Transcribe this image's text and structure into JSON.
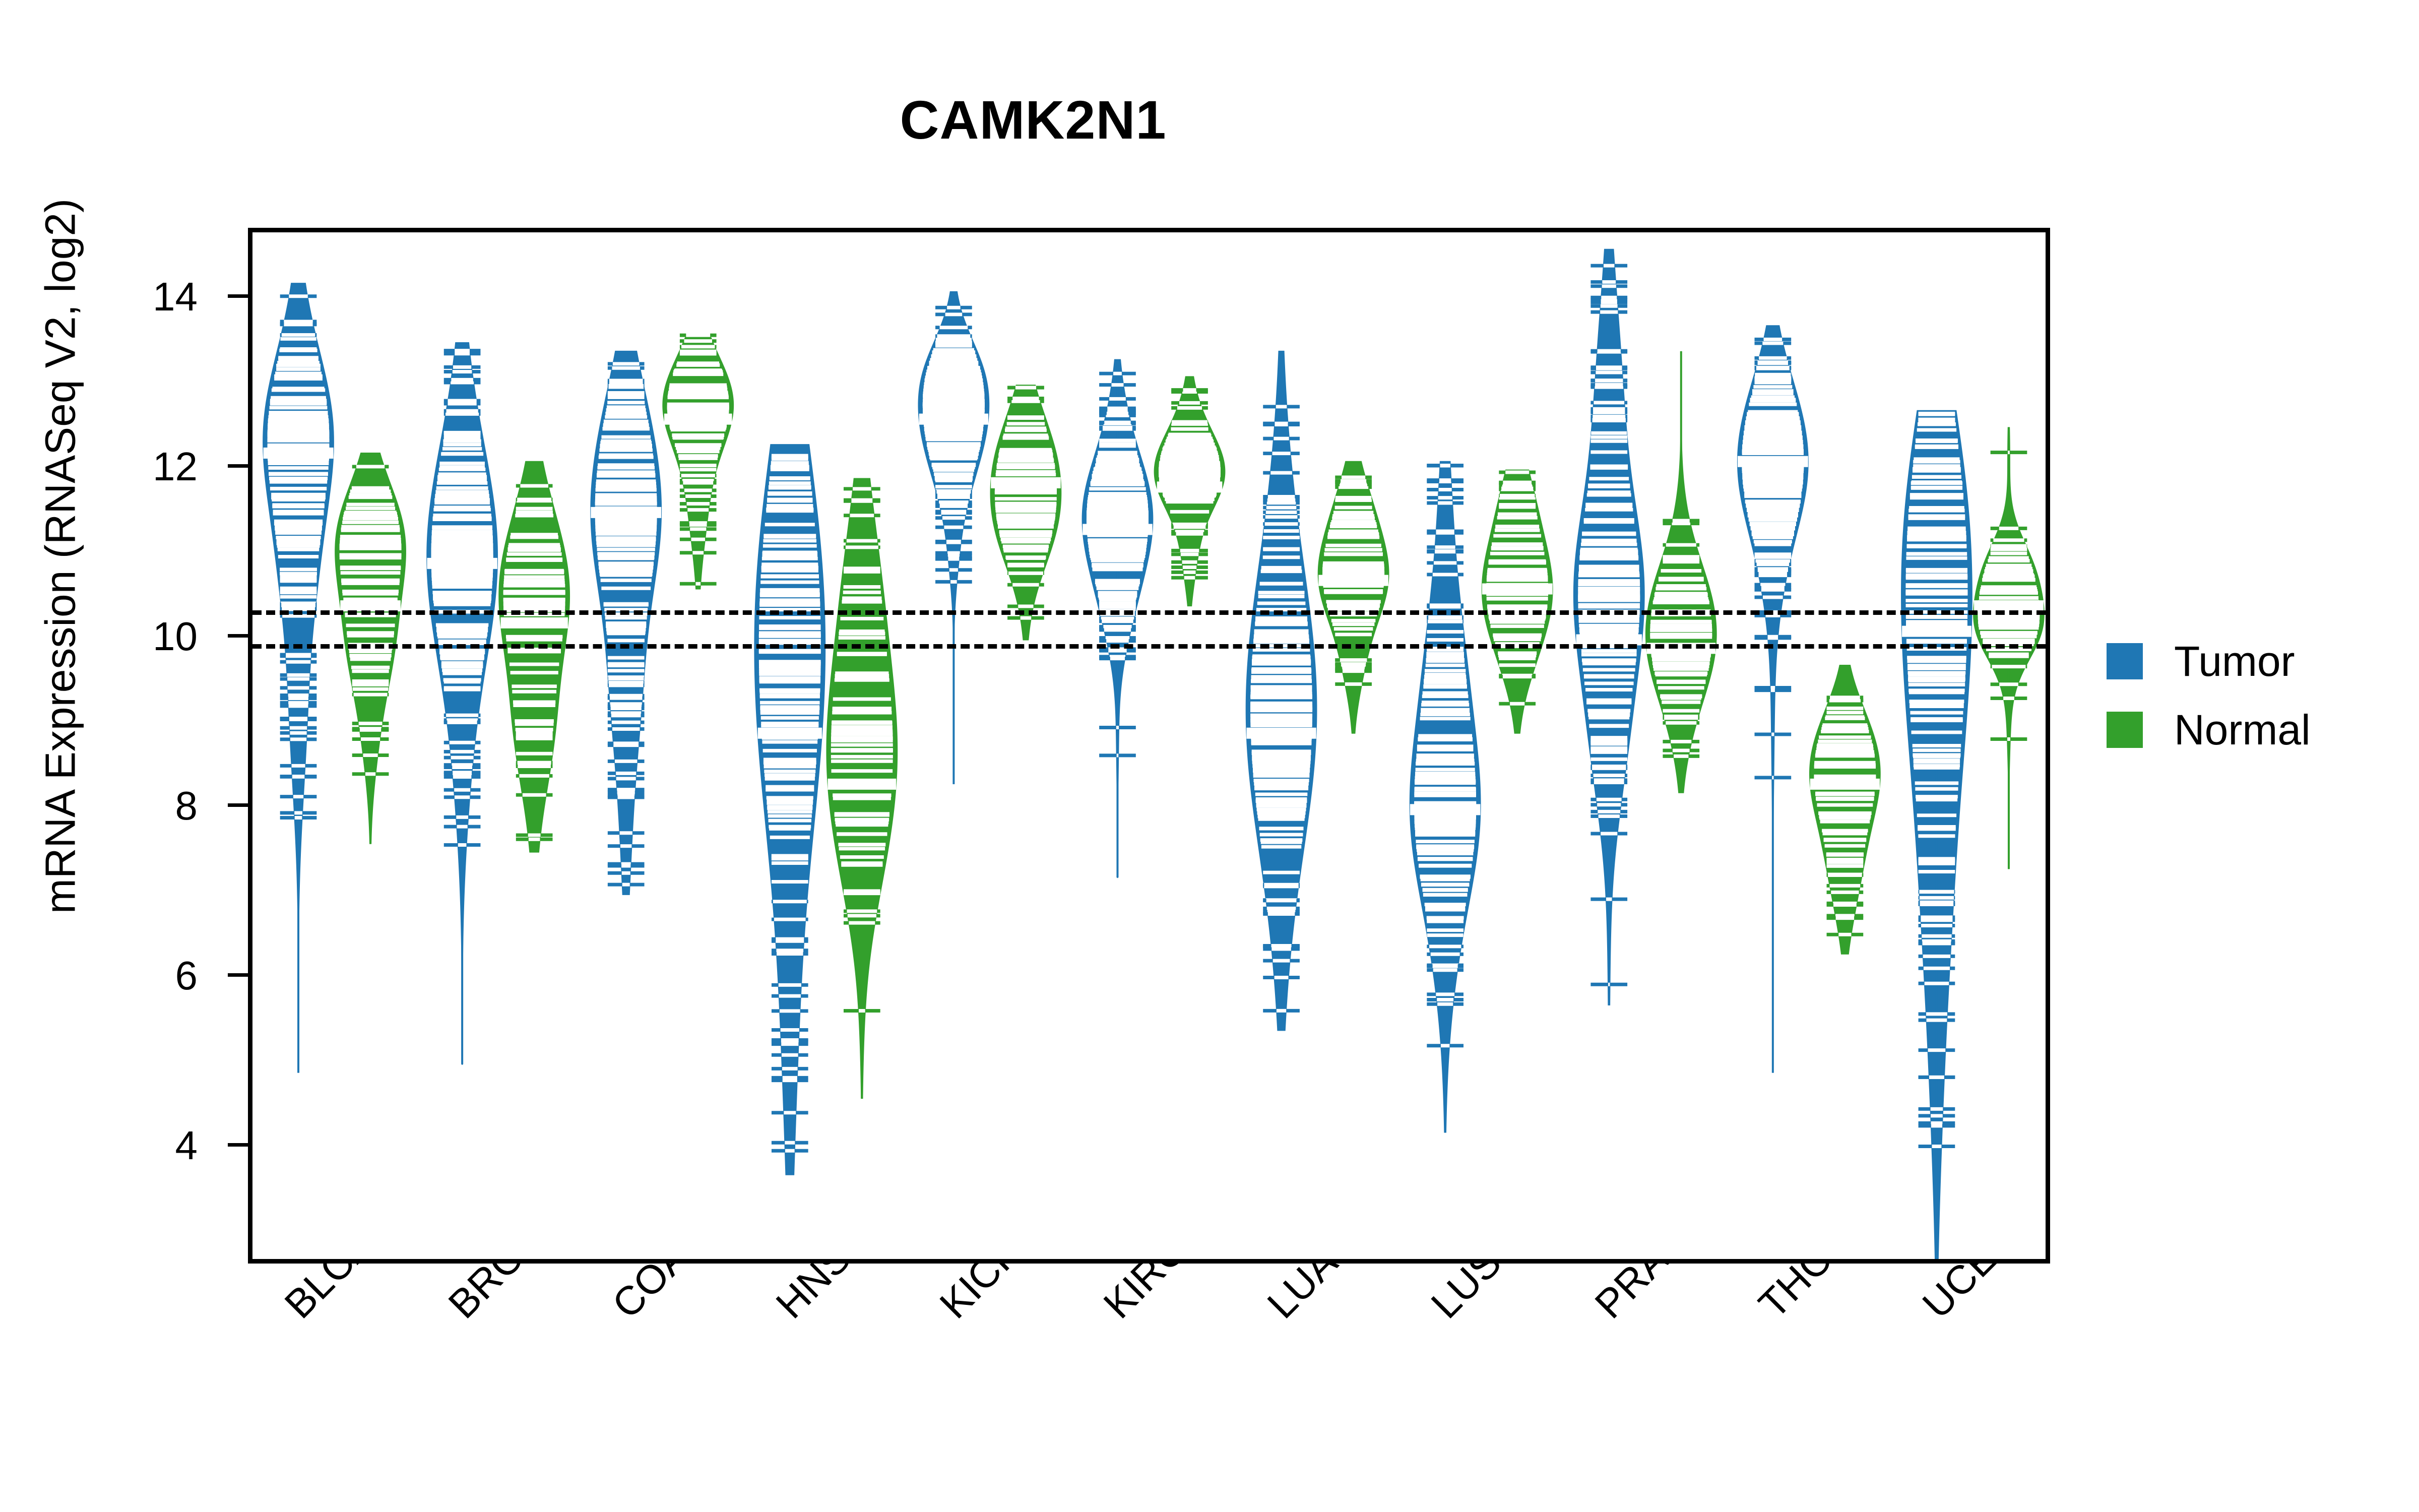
{
  "title": "CAMK2N1",
  "axes": {
    "y_label": "mRNA Expression (RNASeq V2, log2)",
    "y_ticks": [
      "4",
      "6",
      "8",
      "10",
      "12",
      "14"
    ],
    "x_label": ""
  },
  "legend": {
    "position": "right",
    "items": [
      {
        "label": "Tumor",
        "color": "#1f77b4"
      },
      {
        "label": "Normal",
        "color": "#33a02c"
      }
    ]
  },
  "colors": {
    "tumor": "#1f77b4",
    "normal": "#33a02c",
    "axis": "#000000",
    "background": "#ffffff",
    "reference_line": "#000000"
  },
  "chart_data": {
    "type": "violin",
    "title": "CAMK2N1",
    "xlabel": "",
    "ylabel": "mRNA Expression (RNASeq V2, log2)",
    "ylim": [
      2.6,
      14.8
    ],
    "yticks": [
      4,
      6,
      8,
      10,
      12,
      14
    ],
    "grid": false,
    "legend_position": "right",
    "reference_lines": [
      10.35,
      9.95
    ],
    "categories": [
      "BLCA",
      "BRCA",
      "COAD",
      "HNSC",
      "KICH",
      "KIRC",
      "LUAD",
      "LUSC",
      "PRAD",
      "THCA",
      "UCEC"
    ],
    "series": [
      {
        "name": "Tumor",
        "color": "#1f77b4",
        "groups": [
          {
            "category": "BLCA",
            "median": 12.2,
            "q1": 11.1,
            "q3": 12.8,
            "min": 4.9,
            "max": 14.2,
            "peak": 12.3,
            "peak2": 10.2
          },
          {
            "category": "BRCA",
            "median": 10.9,
            "q1": 9.9,
            "q3": 11.9,
            "min": 5.0,
            "max": 13.5,
            "peak": 10.9,
            "peak2": 10.2
          },
          {
            "category": "COAD",
            "median": 11.5,
            "q1": 10.6,
            "q3": 12.3,
            "min": 7.0,
            "max": 13.4,
            "peak": 11.6,
            "peak2": 9.3
          },
          {
            "category": "HNSC",
            "median": 8.9,
            "q1": 7.5,
            "q3": 11.0,
            "min": 3.7,
            "max": 12.3,
            "peak": 11.4,
            "peak2": 8.3
          },
          {
            "category": "KICH",
            "median": 12.6,
            "q1": 12.1,
            "q3": 13.0,
            "min": 8.3,
            "max": 14.1,
            "peak": 12.7,
            "peak2": 12.2
          },
          {
            "category": "KIRC",
            "median": 11.3,
            "q1": 10.7,
            "q3": 11.8,
            "min": 7.2,
            "max": 13.3,
            "peak": 11.5,
            "peak2": 11.1
          },
          {
            "category": "LUAD",
            "median": 8.9,
            "q1": 7.9,
            "q3": 10.4,
            "min": 5.4,
            "max": 13.4,
            "peak": 8.9,
            "peak2": 10.1
          },
          {
            "category": "LUSC",
            "median": 8.0,
            "q1": 7.3,
            "q3": 9.3,
            "min": 4.2,
            "max": 12.1,
            "peak": 8.0,
            "peak2": 9.6
          },
          {
            "category": "PRAD",
            "median": 10.0,
            "q1": 9.2,
            "q3": 11.1,
            "min": 5.7,
            "max": 14.6,
            "peak": 10.0,
            "peak2": 12.5
          },
          {
            "category": "THCA",
            "median": 12.1,
            "q1": 11.5,
            "q3": 12.7,
            "min": 4.9,
            "max": 13.7,
            "peak": 12.2,
            "peak2": 11.6
          },
          {
            "category": "UCEC",
            "median": 10.1,
            "q1": 8.4,
            "q3": 11.4,
            "min": 2.7,
            "max": 12.7,
            "peak": 10.4,
            "peak2": 8.0
          }
        ]
      },
      {
        "name": "Normal",
        "color": "#33a02c",
        "groups": [
          {
            "category": "BLCA",
            "median": 10.4,
            "q1": 9.9,
            "q3": 11.1,
            "min": 7.6,
            "max": 12.2,
            "peak": 11.0,
            "peak2": 10.2
          },
          {
            "category": "BRCA",
            "median": 10.2,
            "q1": 9.4,
            "q3": 10.9,
            "min": 7.5,
            "max": 12.1,
            "peak": 10.4,
            "peak2": 9.7
          },
          {
            "category": "COAD",
            "median": 12.6,
            "q1": 12.1,
            "q3": 13.0,
            "min": 10.6,
            "max": 13.6,
            "peak": 12.8,
            "peak2": 12.3
          },
          {
            "category": "HNSC",
            "median": 8.3,
            "q1": 7.7,
            "q3": 9.6,
            "min": 4.6,
            "max": 11.9,
            "peak": 8.3,
            "peak2": 10.4
          },
          {
            "category": "KICH",
            "median": 11.85,
            "q1": 11.3,
            "q3": 12.3,
            "min": 10.0,
            "max": 13.0,
            "peak": 11.9,
            "peak2": 11.6
          },
          {
            "category": "KIRC",
            "median": 11.8,
            "q1": 11.4,
            "q3": 12.2,
            "min": 10.4,
            "max": 13.1,
            "peak": 11.9,
            "peak2": 11.7
          },
          {
            "category": "LUAD",
            "median": 10.7,
            "q1": 10.2,
            "q3": 11.2,
            "min": 8.9,
            "max": 12.1,
            "peak": 10.9,
            "peak2": 10.4
          },
          {
            "category": "LUSC",
            "median": 10.6,
            "q1": 10.1,
            "q3": 11.2,
            "min": 8.9,
            "max": 12.0,
            "peak": 10.8,
            "peak2": 10.4
          },
          {
            "category": "PRAD",
            "median": 9.9,
            "q1": 9.4,
            "q3": 10.5,
            "min": 8.2,
            "max": 13.4,
            "peak": 10.3,
            "peak2": 9.8
          },
          {
            "category": "THCA",
            "median": 8.3,
            "q1": 7.8,
            "q3": 8.8,
            "min": 6.3,
            "max": 9.7,
            "peak": 8.4,
            "peak2": 7.9
          },
          {
            "category": "UCEC",
            "median": 10.4,
            "q1": 10.0,
            "q3": 10.8,
            "min": 7.3,
            "max": 12.5,
            "peak": 10.5,
            "peak2": 10.2
          }
        ]
      }
    ]
  }
}
